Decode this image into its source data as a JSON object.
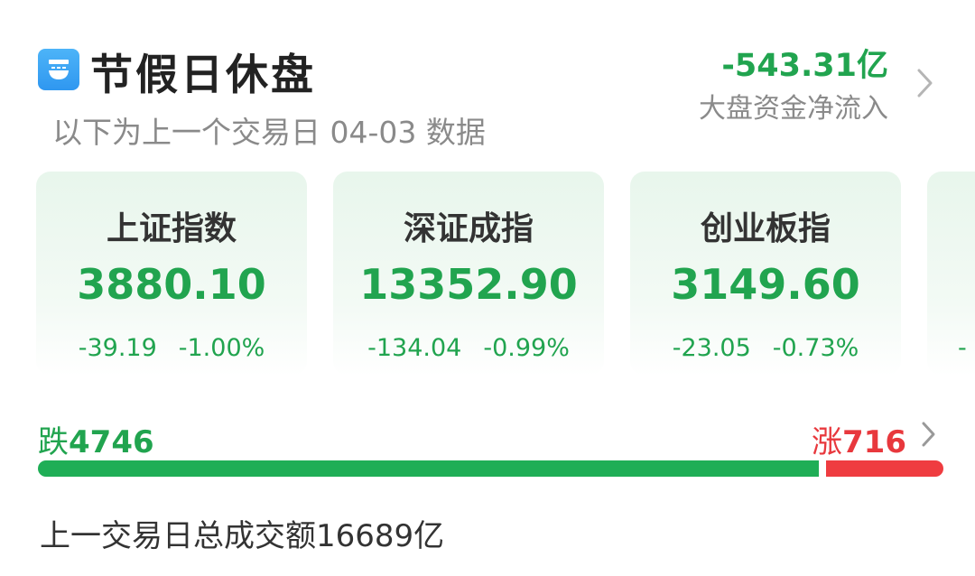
{
  "header": {
    "icon": "rice-bowl-icon",
    "title": "节假日休盘",
    "subtitle": "以下为上一个交易日 04-03 数据",
    "net_flow_value": "-543.31亿",
    "net_flow_label": "大盘资金净流入"
  },
  "indices": [
    {
      "name": "上证指数",
      "value": "3880.10",
      "change": "-39.19",
      "change_pct": "-1.00%"
    },
    {
      "name": "深证成指",
      "value": "13352.90",
      "change": "-134.04",
      "change_pct": "-0.99%"
    },
    {
      "name": "创业板指",
      "value": "3149.60",
      "change": "-23.05",
      "change_pct": "-0.73%"
    },
    {
      "name": "",
      "value": "",
      "change": "-",
      "change_pct": ""
    }
  ],
  "breadth": {
    "fall_label": "跌",
    "fall_count": "4746",
    "rise_label": "涨",
    "rise_count": "716",
    "fall_share": 0.869
  },
  "turnover": "上一交易日总成交额16689亿",
  "colors": {
    "down": "#21a44f",
    "up": "#e8383d",
    "card_bg": "#e8f6ec"
  }
}
